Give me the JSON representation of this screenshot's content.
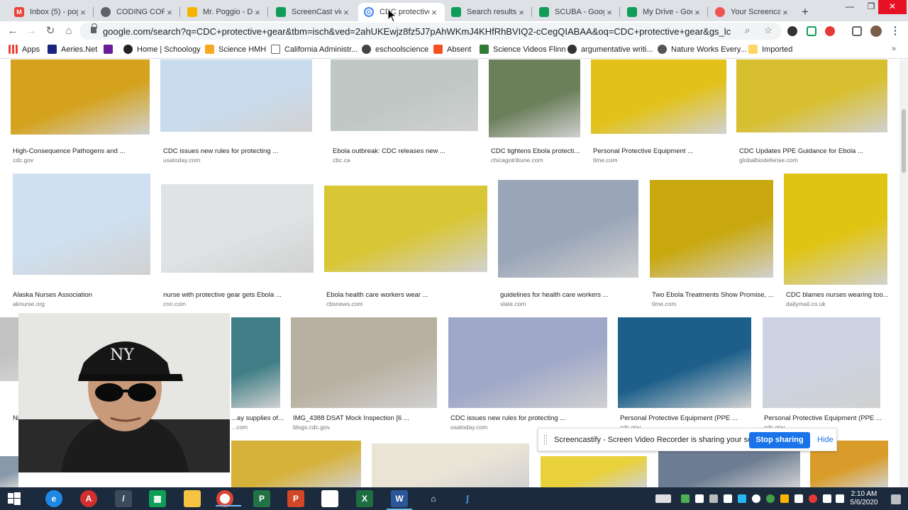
{
  "browser": {
    "tabs": [
      {
        "title": "Inbox (5) - pogg",
        "active": false
      },
      {
        "title": "CODING CORC",
        "active": false
      },
      {
        "title": "Mr. Poggio - Do",
        "active": false
      },
      {
        "title": "ScreenCast vide",
        "active": false
      },
      {
        "title": "CDC protective",
        "active": true
      },
      {
        "title": "Search results",
        "active": false
      },
      {
        "title": "SCUBA - Googl",
        "active": false
      },
      {
        "title": "My Drive - Goo",
        "active": false
      },
      {
        "title": "Your Screencas",
        "active": false
      }
    ],
    "new_tab": "+",
    "window_controls": {
      "minimize": "—",
      "maximize": "❐",
      "close": "✕"
    },
    "url": "google.com/search?q=CDC+protective+gear&tbm=isch&ved=2ahUKEwjz8fz5J7pAhWKmJ4KHfRhBVIQ2-cCegQIABAA&oq=CDC+protective+gear&gs_lcp=CgNpbWcQAz..."
  },
  "bookmarks": [
    {
      "label": "Apps",
      "color": "#ea4335"
    },
    {
      "label": "Aeries.Net",
      "color": "#1a237e"
    },
    {
      "label": "",
      "color": "#6a1b9a"
    },
    {
      "label": "Home | Schoology",
      "color": "#222222"
    },
    {
      "label": "Science HMH",
      "color": "#f9a825"
    },
    {
      "label": "California Administr...",
      "color": "#5f6368"
    },
    {
      "label": "eschoolscience",
      "color": "#444444"
    },
    {
      "label": "Absent",
      "color": "#f4511e"
    },
    {
      "label": "Science Videos Flinn",
      "color": "#2e7d32"
    },
    {
      "label": "argumentative writi...",
      "color": "#333333"
    },
    {
      "label": "Nature Works Every...",
      "color": "#555555"
    },
    {
      "label": "Imported",
      "color": "#fdd663"
    }
  ],
  "results": [
    {
      "caption": "High-Consequence Pathogens and ...",
      "source": "cdc.gov",
      "color": "#d4a21c"
    },
    {
      "caption": "CDC issues new rules for protecting ...",
      "source": "usatoday.com",
      "color": "#c8dcee"
    },
    {
      "caption": "Ebola outbreak: CDC releases new ...",
      "source": "cbc.ca",
      "color": "#bfc8c4"
    },
    {
      "caption": "CDC tightens Ebola protecti...",
      "source": "chicagotribune.com",
      "color": "#6b7f5a"
    },
    {
      "caption": "Personal Protective Equipment ...",
      "source": "time.com",
      "color": "#e2c21a"
    },
    {
      "caption": "CDC Updates PPE Guidance for Ebola ...",
      "source": "globalbiodefense.com",
      "color": "#d8bf30"
    },
    {
      "caption": "Alaska Nurses Association",
      "source": "aknurse.org",
      "color": "#cfe0f0"
    },
    {
      "caption": "nurse with protective gear gets Ebola ...",
      "source": "cnn.com",
      "color": "#dfe3e4"
    },
    {
      "caption": "Ebola health care workers wear ...",
      "source": "cbsnews.com",
      "color": "#d9c634"
    },
    {
      "caption": "guidelines for health care workers ...",
      "source": "slate.com",
      "color": "#9aa6b8"
    },
    {
      "caption": "Two Ebola Treatments Show Promise, ...",
      "source": "time.com",
      "color": "#c9a80e"
    },
    {
      "caption": "CDC blames nurses wearing too...",
      "source": "dailymail.co.uk",
      "color": "#e0c414"
    },
    {
      "caption": "Ni...",
      "source": "",
      "color": "#c2c2c2"
    },
    {
      "caption": "...ay supplies of...",
      "source": "...com",
      "color": "#3f7e86"
    },
    {
      "caption": "IMG_4388 DSAT Mock Inspection [6 ...",
      "source": "blogs.cdc.gov",
      "color": "#b8b0a0"
    },
    {
      "caption": "CDC issues new rules for protecting ...",
      "source": "usatoday.com",
      "color": "#9fa8c8"
    },
    {
      "caption": "Personal Protective Equipment (PPE ...",
      "source": "cdc.gov",
      "color": "#1d5f8a"
    },
    {
      "caption": "Personal Protective Equipment (PPE ...",
      "source": "cdc.gov",
      "color": "#cdd3e0"
    },
    {
      "caption": "",
      "source": "",
      "color": "#8899aa"
    },
    {
      "caption": "",
      "source": "",
      "color": "#d7b23a"
    },
    {
      "caption": "",
      "source": "",
      "color": "#eae4d6"
    },
    {
      "caption": "",
      "source": "",
      "color": "#e9d13c"
    },
    {
      "caption": "",
      "source": "",
      "color": "#6c7c92"
    },
    {
      "caption": "",
      "source": "",
      "color": "#d99c2a"
    }
  ],
  "screencastify": {
    "message": "Screencastify - Screen Video Recorder is sharing your screen.",
    "stop_label": "Stop sharing",
    "hide_label": "Hide"
  },
  "taskbar": {
    "apps": [
      "start",
      "edge",
      "acrobat",
      "pen",
      "sheets",
      "files",
      "chrome",
      "project",
      "powerpoint",
      "notepad",
      "excel",
      "word",
      "home",
      "feather"
    ],
    "time": "2:10 AM",
    "date": "5/6/2020"
  },
  "colors": {
    "accent": "#1a73e8",
    "taskbar": "#1b2b3d",
    "close": "#e81123"
  }
}
